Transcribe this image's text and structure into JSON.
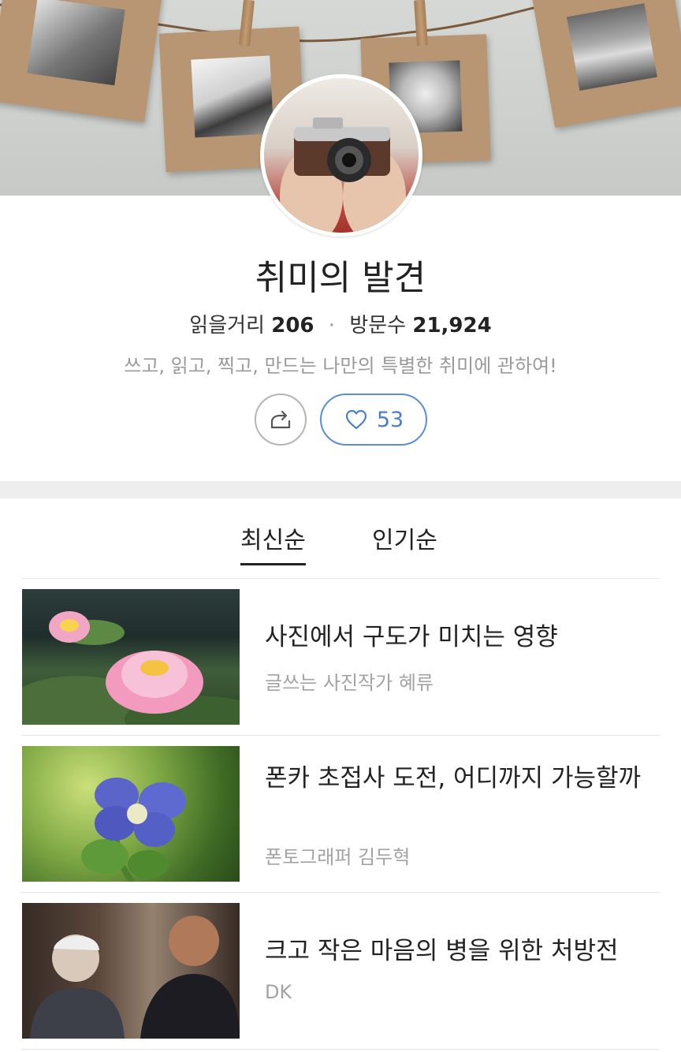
{
  "profile": {
    "title": "취미의 발견",
    "articles_label": "읽을거리",
    "articles_count": "206",
    "visitors_label": "방문수",
    "visitors_count": "21,924",
    "description": "쓰고, 읽고, 찍고, 만드는 나만의 특별한 취미에 관하여!",
    "like_count": "53"
  },
  "icons": {
    "share": "share-icon",
    "like": "heart-icon"
  },
  "colors": {
    "accent_blue": "#4a7fc9",
    "secondary_text": "#9a9a9a"
  },
  "sort_tabs": [
    {
      "label": "최신순",
      "active": true
    },
    {
      "label": "인기순",
      "active": false
    }
  ],
  "articles": [
    {
      "title": "사진에서 구도가 미치는 영향",
      "author": "글쓰는 사진작가 혜류",
      "image": "pink water lily on lily pads"
    },
    {
      "title": "폰카 초접사 도전, 어디까지 가능할까",
      "author": "폰토그래퍼 김두혁",
      "image": "small blue flower close-up"
    },
    {
      "title": "크고 작은 마음의 병을 위한 처방전",
      "author": "DK",
      "image": "two men talking outdoors"
    }
  ]
}
